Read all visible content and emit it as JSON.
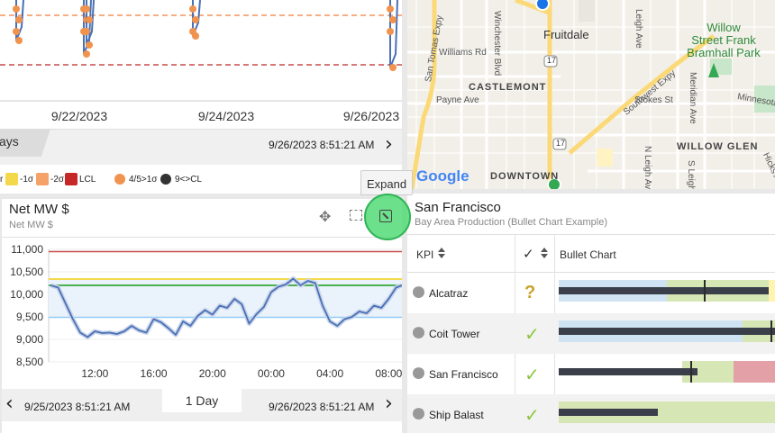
{
  "top_chart": {
    "x_ticks": [
      "9/22/2023",
      "9/24/2023",
      "9/26/2023"
    ],
    "range_label": "ays",
    "end_date": "9/26/2023 8:51:21 AM",
    "colors": {
      "line": "#4a70b5",
      "points": "#f0934e",
      "ucl": "#f2935a",
      "lcl": "#c74b4b"
    },
    "legend": [
      {
        "label": "r",
        "color": ""
      },
      {
        "label": "-1σ",
        "color": "#f3d94a"
      },
      {
        "label": "-2σ",
        "color": "#f4a268"
      },
      {
        "label": "LCL",
        "color": "#c62828"
      },
      {
        "label": "4/5>1σ",
        "color": "#f0934e"
      },
      {
        "label": "9<>CL",
        "color": "#333333"
      }
    ]
  },
  "map": {
    "labels": {
      "fruitdale": "Fruitdale",
      "williams": "Williams Rd",
      "castlemont": "CASTLEMONT",
      "payne": "Payne Ave",
      "willow_glen": "WILLOW GLEN",
      "downtown": "DOWNTOWN",
      "willow_street": "Willow",
      "willow_street2": "Street Frank",
      "willow_street3": "Bramhall Park",
      "san_tomas": "San Tomas Expy",
      "winchester": "Winchester Blvd",
      "leigh": "Leigh Ave",
      "meridian": "Meridian Ave",
      "stokes": "Stokes St",
      "southwest": "Southwest Expy",
      "minnesota": "Minnesota",
      "hicks": "Hicks Ave",
      "n_leigh": "N Leigh Ave",
      "s_leigh": "S Leigh Ave",
      "route17": "17",
      "google": "Google"
    }
  },
  "net_chart": {
    "title": "Net MW $",
    "subtitle": "Net MW $",
    "tooltip": "Expand",
    "range_label": "1 Day",
    "start_date": "9/25/2023 8:51:21 AM",
    "end_date": "9/26/2023 8:51:21 AM",
    "chart_data": {
      "type": "line",
      "title": "Net MW $",
      "y_ticks": [
        "11,000",
        "10,500",
        "10,000",
        "9,500",
        "9,000",
        "8,500"
      ],
      "ylim": [
        8500,
        11000
      ],
      "x_ticks": [
        "12:00",
        "16:00",
        "20:00",
        "00:00",
        "04:00",
        "08:00"
      ],
      "xlim": [
        8.85,
        32.9
      ],
      "limits": {
        "ucl": 10950,
        "plus1": 10340,
        "cl": 10200,
        "minus1": 9490
      },
      "colors": {
        "ucl": "#c74b4b",
        "plus1": "#f3d94a",
        "cl": "#4caf50",
        "minus1": "#90caf9",
        "line": "#4a70b5"
      },
      "x": [
        9.0,
        9.5,
        10.0,
        10.5,
        11.0,
        11.5,
        12.0,
        12.5,
        13.0,
        13.5,
        14.0,
        14.5,
        15.0,
        15.5,
        16.0,
        16.5,
        17.0,
        17.5,
        18.0,
        18.5,
        19.0,
        19.5,
        20.0,
        20.5,
        21.0,
        21.5,
        22.0,
        22.5,
        23.0,
        23.5,
        24.0,
        24.5,
        25.0,
        25.5,
        26.0,
        26.5,
        27.0,
        27.5,
        28.0,
        28.5,
        29.0,
        29.5,
        30.0,
        30.5,
        31.0,
        31.5,
        32.0,
        32.5,
        32.9
      ],
      "values": [
        10200,
        10150,
        9800,
        9450,
        9150,
        9050,
        9180,
        9140,
        9150,
        9120,
        9180,
        9300,
        9200,
        9150,
        9450,
        9380,
        9250,
        9100,
        9400,
        9300,
        9520,
        9650,
        9550,
        9750,
        9700,
        9900,
        9780,
        9350,
        9560,
        9720,
        10050,
        10170,
        10220,
        10350,
        10200,
        10300,
        10250,
        9750,
        9400,
        9300,
        9450,
        9500,
        9620,
        9580,
        9750,
        9700,
        9900,
        10150,
        10200
      ]
    }
  },
  "kpi_panel": {
    "title": "San Francisco",
    "subtitle": "Bay Area Production (Bullet Chart Example)",
    "columns": {
      "kpi": "KPI",
      "bullet": "Bullet Chart"
    },
    "rows": [
      {
        "name": "Alcatraz",
        "status": "?",
        "status_color": "#c9a227",
        "bands": [
          {
            "from": 0,
            "to": 0.5,
            "color": "#cfe3f3"
          },
          {
            "from": 0.5,
            "to": 0.97,
            "color": "#d6e6b4"
          },
          {
            "from": 0.97,
            "to": 1.0,
            "color": "#fff3b0"
          }
        ],
        "bar": 0.97,
        "target": 0.67
      },
      {
        "name": "Coit Tower",
        "status": "✓",
        "status_color": "#8cc63f",
        "bands": [
          {
            "from": 0,
            "to": 0.85,
            "color": "#cfe3f3"
          },
          {
            "from": 0.85,
            "to": 1.0,
            "color": "#d6e6b4"
          }
        ],
        "bar": 1.0,
        "target": 0.98
      },
      {
        "name": "San Francisco",
        "status": "✓",
        "status_color": "#8cc63f",
        "bands": [
          {
            "from": 0,
            "to": 0.57,
            "color": "#ffffff"
          },
          {
            "from": 0.57,
            "to": 0.81,
            "color": "#d6e6b4"
          },
          {
            "from": 0.81,
            "to": 1.0,
            "color": "#e3a0a6"
          }
        ],
        "bar": 0.64,
        "target": 0.61
      },
      {
        "name": "Ship Balast",
        "status": "✓",
        "status_color": "#8cc63f",
        "bands": [
          {
            "from": 0,
            "to": 1.0,
            "color": "#d6e6b4"
          }
        ],
        "bar": 0.46,
        "target": -1
      }
    ]
  }
}
